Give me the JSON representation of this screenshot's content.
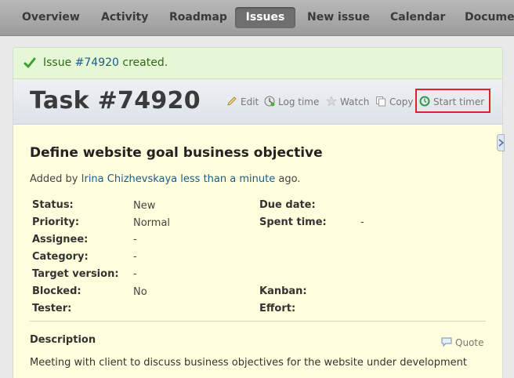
{
  "nav": {
    "tabs": [
      {
        "label": "Overview"
      },
      {
        "label": "Activity"
      },
      {
        "label": "Roadmap"
      },
      {
        "label": "Issues",
        "selected": true
      },
      {
        "label": "New issue"
      },
      {
        "label": "Calendar"
      },
      {
        "label": "Documents"
      }
    ]
  },
  "flash": {
    "prefix": "Issue ",
    "link": "#74920",
    "suffix": " created."
  },
  "header": {
    "title": "Task #74920",
    "actions": {
      "edit": "Edit",
      "log_time": "Log time",
      "watch": "Watch",
      "copy": "Copy",
      "start_timer": "Start timer"
    }
  },
  "issue": {
    "subject": "Define website goal business objective",
    "added_by_prefix": "Added by ",
    "author": "Irina Chizhevskaya",
    "time_link": "less than a minute",
    "added_suffix": " ago.",
    "attributes_left": [
      {
        "label": "Status:",
        "value": "New"
      },
      {
        "label": "Priority:",
        "value": "Normal"
      },
      {
        "label": "Assignee:",
        "value": "-"
      },
      {
        "label": "Category:",
        "value": "-"
      },
      {
        "label": "Target version:",
        "value": "-"
      },
      {
        "label": "Blocked:",
        "value": "No"
      },
      {
        "label": "Tester:",
        "value": ""
      }
    ],
    "attributes_right": [
      {
        "label": "Due date:",
        "value": ""
      },
      {
        "label": "Spent time:",
        "value": "-"
      },
      {
        "label": "Kanban:",
        "value": ""
      },
      {
        "label": "Effort:",
        "value": ""
      }
    ],
    "description_title": "Description",
    "quote_label": "Quote",
    "description_text": "Meeting with client to discuss business objectives for the website under development"
  },
  "colors": {
    "nav_selected": "#6f6f6f",
    "flash_bg": "#e5f7d5",
    "issue_bg": "#ffffdd",
    "link": "#1c5b8a",
    "highlight": "#d6262c"
  },
  "icons": [
    "checkmark-icon",
    "pencil-icon",
    "clock-icon",
    "star-icon",
    "copy-icon",
    "timer-icon",
    "quote-icon",
    "chevron-right-icon"
  ]
}
